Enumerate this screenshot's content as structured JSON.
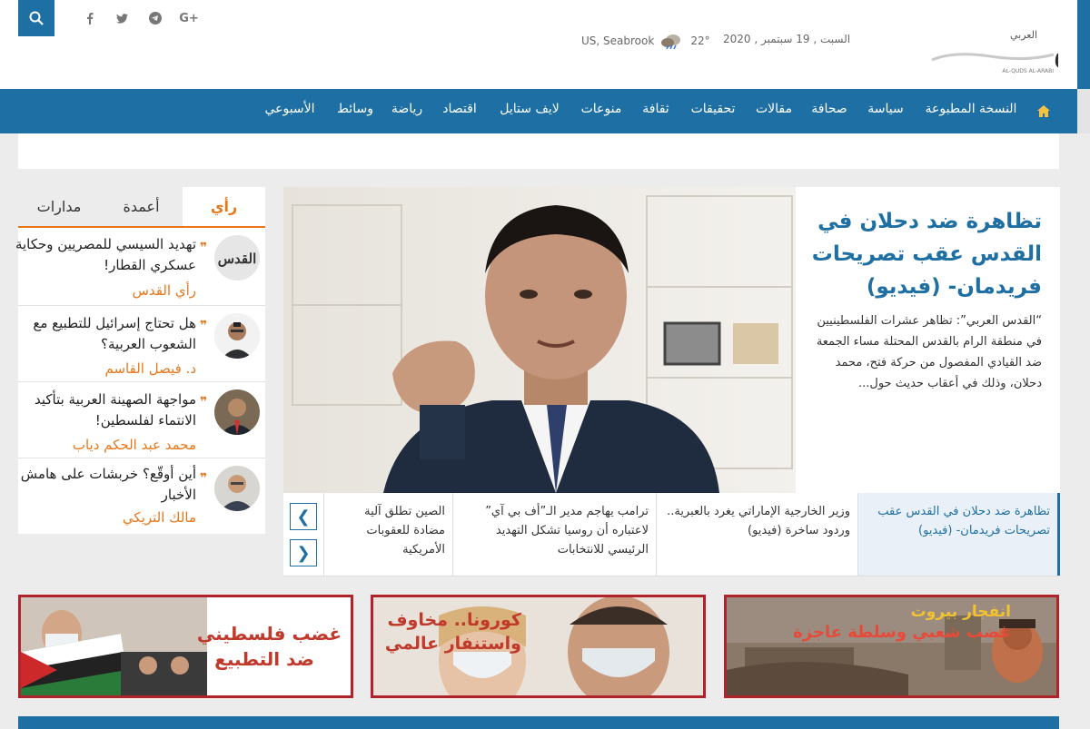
{
  "header": {
    "date": "السبت , 19 سبتمبر , 2020",
    "temperature": "22°",
    "location": "US, Seabrook",
    "logo_text": "القدس العربي",
    "logo_subtext": "AL-QUDS AL-ARABI",
    "social_icons": [
      "facebook-icon",
      "twitter-icon",
      "telegram-icon",
      "google-plus-icon"
    ]
  },
  "nav": {
    "items": [
      {
        "label": "النسخة المطبوعة"
      },
      {
        "label": "سياسة"
      },
      {
        "label": "صحافة"
      },
      {
        "label": "مقالات"
      },
      {
        "label": "تحقيقات"
      },
      {
        "label": "ثقافة"
      },
      {
        "label": "منوعات"
      },
      {
        "label": "لايف ستايل"
      },
      {
        "label": "اقتصاد"
      },
      {
        "label": "رياضة"
      },
      {
        "label": "وسائط"
      },
      {
        "label": "الأسبوعي"
      }
    ]
  },
  "opinion": {
    "tabs": [
      "رأي",
      "أعمدة",
      "مدارات"
    ],
    "items": [
      {
        "title": "تهديد السيسي للمصريين وحكاية عسكري القطار!",
        "author": "رأي القدس"
      },
      {
        "title": "هل تحتاج إسرائيل للتطبيع مع الشعوب العربية؟",
        "author": "د. فيصل القاسم"
      },
      {
        "title": "مواجهة الصهينة العربية بتأكيد الانتماء لفلسطين!",
        "author": "محمد عبد الحكم دياب"
      },
      {
        "title": "أين أوقّع؟ خربشات على هامش الأخبار",
        "author": "مالك التريكي"
      }
    ]
  },
  "featured": {
    "title": "تظاهرة ضد دحلان في القدس عقب تصريحات فريدمان- (فيديو)",
    "excerpt": "“القدس العربي”: تظاهر عشرات الفلسطينيين في منطقة الرام بالقدس المحتلة مساء الجمعة ضد القيادي المفصول من حركة فتح، محمد دحلان، وذلك في أعقاب حديث حول..."
  },
  "ticker": [
    "تظاهرة ضد دحلان في القدس عقب تصريحات فريدمان- (فيديو)",
    "وزير الخارجية الإماراتي يغرد بالعبرية.. وردود ساخرة (فيديو)",
    "ترامب يهاجم مدير الـ”أف بي آي” لاعتباره أن روسيا تشكل التهديد الرئيسي للانتخابات",
    "الصين تطلق آلية مضادة للعقوبات الأمريكية"
  ],
  "banners": [
    {
      "line1": "انفجار بيروت",
      "line2": "غضب شعبي وسلطة عاجزة"
    },
    {
      "line1": "كورونا.. مخاوف",
      "line2": "واستنفار عالمي"
    },
    {
      "line1": "غضب فلسطيني",
      "line2": "ضد التطبيع"
    }
  ],
  "colors": {
    "brand_blue": "#1e6fa3",
    "accent_orange": "#e8771c",
    "banner_red": "#b0232a"
  }
}
